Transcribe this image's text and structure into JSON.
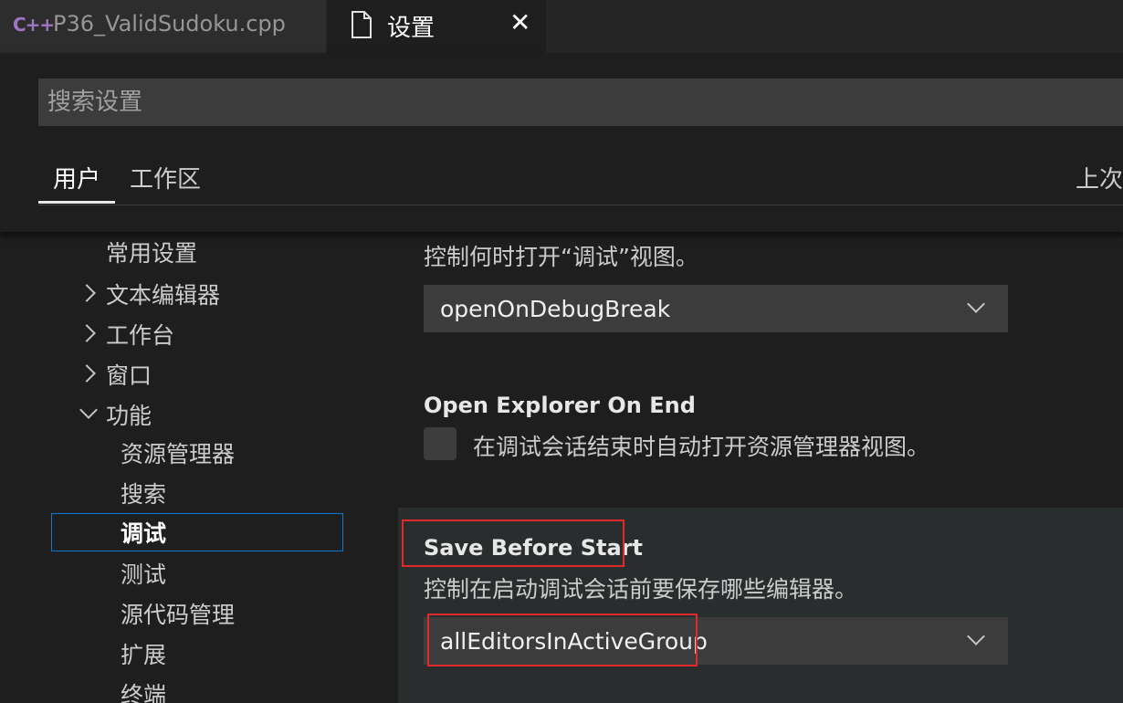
{
  "tabs": {
    "cpp_file": {
      "icon_text": "C++",
      "label": "P36_ValidSudoku.cpp"
    },
    "settings": {
      "label": "设置"
    }
  },
  "search": {
    "placeholder": "搜索设置"
  },
  "scope_tabs": {
    "user": "用户",
    "workspace": "工作区",
    "last_sync": "上次"
  },
  "toc": {
    "commonly_used": "常用设置",
    "text_editor": "文本编辑器",
    "workbench": "工作台",
    "window": "窗口",
    "features": "功能",
    "explorer": "资源管理器",
    "search": "搜索",
    "debug": "调试",
    "testing": "测试",
    "scm": "源代码管理",
    "extensions": "扩展",
    "terminal": "终端"
  },
  "settings": {
    "open_debug": {
      "description": "控制何时打开“调试”视图。",
      "value": "openOnDebugBreak"
    },
    "open_explorer_on_end": {
      "title": "Open Explorer On End",
      "description": "在调试会话结束时自动打开资源管理器视图。",
      "checked": false
    },
    "save_before_start": {
      "title": "Save Before Start",
      "description": "控制在启动调试会话前要保存哪些编辑器。",
      "value": "allEditorsInActiveGroup"
    }
  },
  "colors": {
    "background": "#1e1e1e",
    "focus_border": "#0e7ad3",
    "highlight_box": "#e02a2a",
    "cpp_icon": "#a074c4"
  }
}
